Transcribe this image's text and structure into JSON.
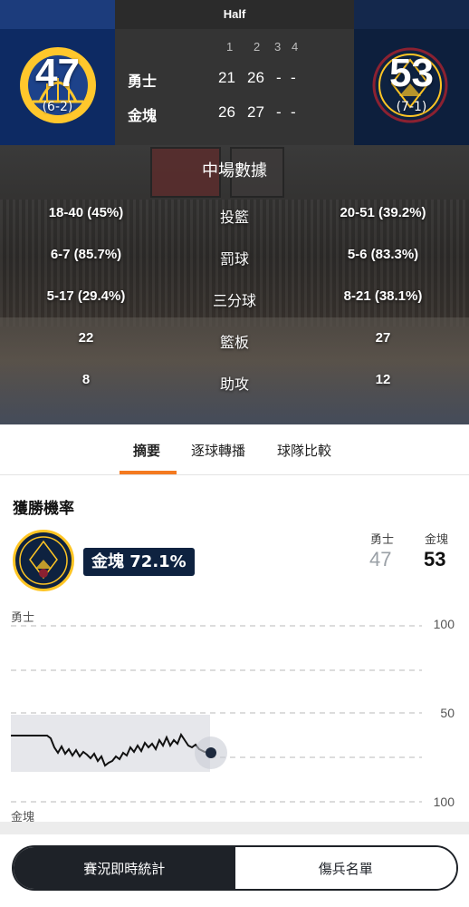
{
  "header": {
    "period_label": "Half",
    "quarters": [
      "1",
      "2",
      "3",
      "4"
    ],
    "home": {
      "score": "47",
      "record": "(6-2)",
      "name": "勇士",
      "quarters": [
        "21",
        "26",
        "-",
        "-"
      ]
    },
    "away": {
      "score": "53",
      "record": "(7-1)",
      "name": "金塊",
      "quarters": [
        "26",
        "27",
        "-",
        "-"
      ]
    },
    "colors": {
      "home_panel": "#0d2a63",
      "away_panel": "#0d1f3d",
      "center_panel": "#343434"
    }
  },
  "halftime_stats": {
    "title": "中場數據",
    "rows": [
      {
        "label": "投籃",
        "home": "18-40 (45%)",
        "away": "20-51 (39.2%)"
      },
      {
        "label": "罰球",
        "home": "6-7 (85.7%)",
        "away": "5-6 (83.3%)"
      },
      {
        "label": "三分球",
        "home": "5-17 (29.4%)",
        "away": "8-21 (38.1%)"
      },
      {
        "label": "籃板",
        "home": "22",
        "away": "27"
      },
      {
        "label": "助攻",
        "home": "8",
        "away": "12"
      }
    ]
  },
  "tabs": {
    "items": [
      "摘要",
      "逐球轉播",
      "球隊比較"
    ],
    "active_index": 0,
    "indicator_color": "#f47a20"
  },
  "win_probability": {
    "title": "獲勝機率",
    "leader_badge": "金塊 72.1%",
    "home_label": "勇士",
    "away_label": "金塊",
    "home_score": "47",
    "away_score": "53",
    "chart_top_label": "勇士",
    "chart_bottom_label": "金塊",
    "axis_labels": [
      "100",
      "50",
      "100"
    ],
    "badge_color": "#0e2240"
  },
  "bottom_buttons": {
    "live_stats": "賽況即時統計",
    "injuries": "傷兵名單",
    "active": "live_stats"
  }
}
